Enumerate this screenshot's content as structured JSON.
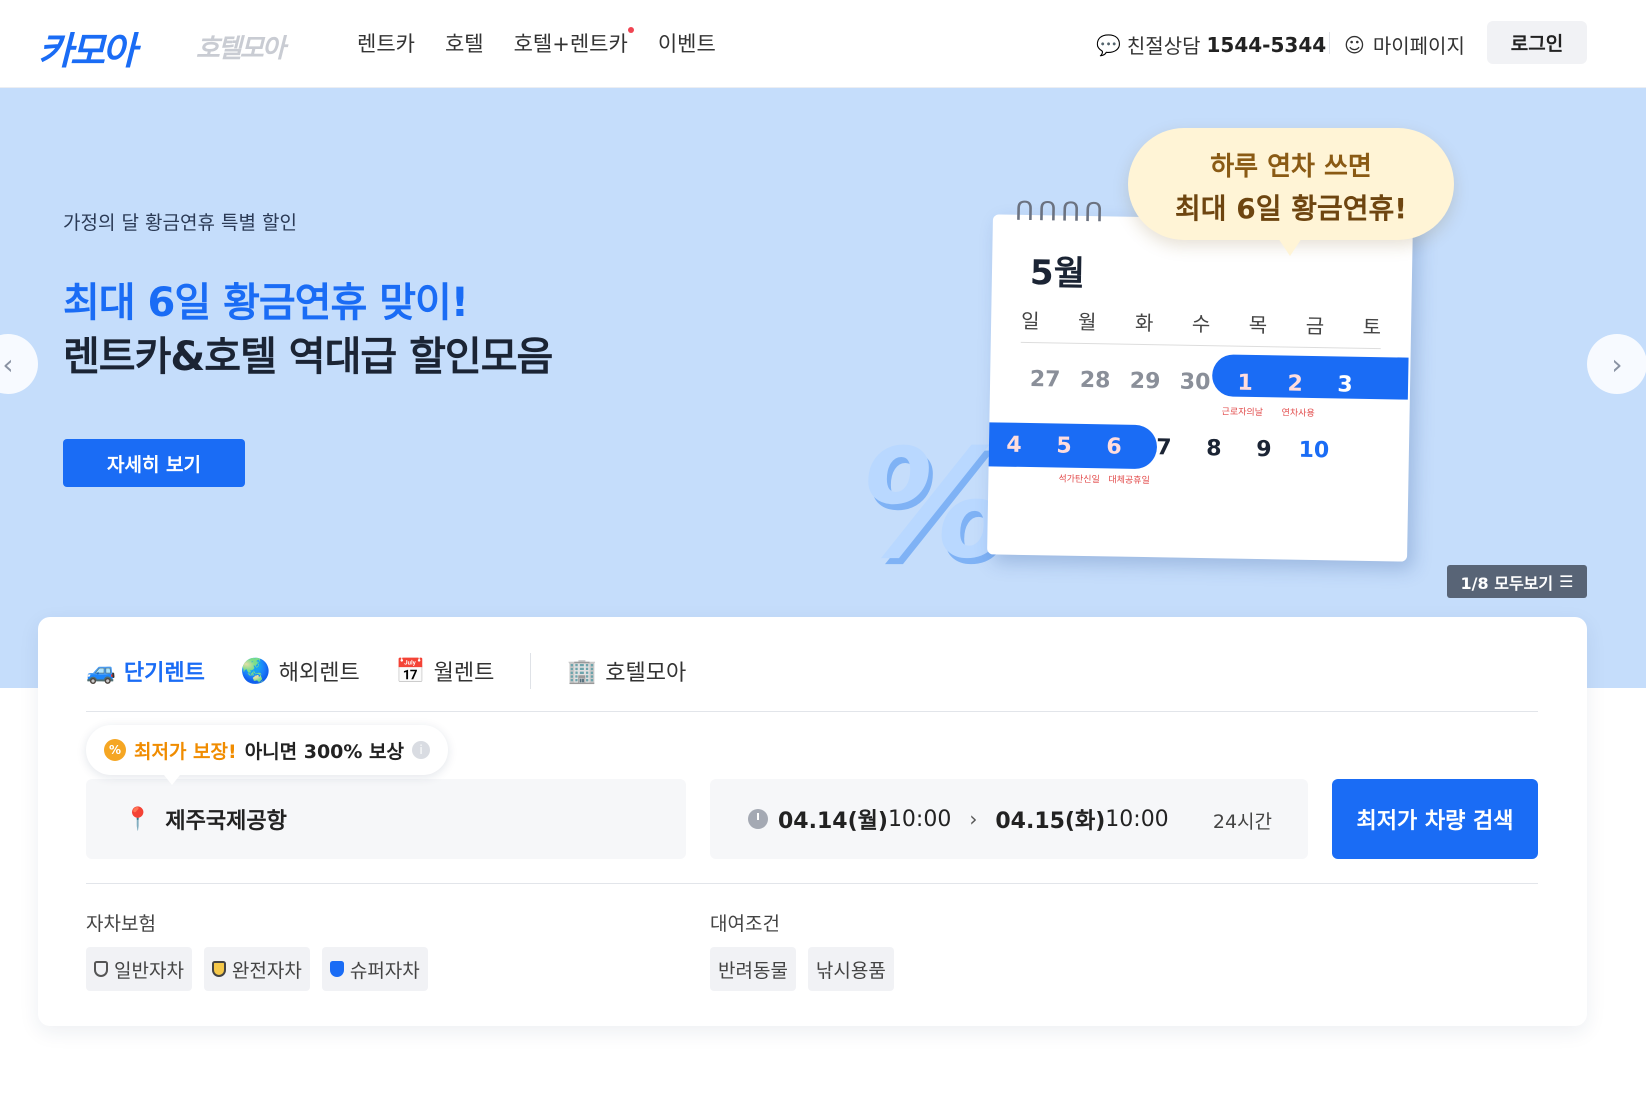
{
  "header": {
    "logo": "카모아",
    "logo_sub": "호텔모아",
    "nav": [
      "렌트카",
      "호텔",
      "호텔+렌트카",
      "이벤트"
    ],
    "consult_label": "친절상담",
    "consult_phone": "1544-5344",
    "mypage": "마이페이지",
    "login": "로그인"
  },
  "hero": {
    "eyebrow": "가정의 달 황금연휴 특별 할인",
    "title_line1": "최대 6일 황금연휴 맞이!",
    "title_line2": "렌트카&호텔 역대급 할인모음",
    "cta": "자세히 보기",
    "pager": "1/8 모두보기",
    "speech_line1": "하루 연차 쓰면",
    "speech_line2": "최대 6일 황금연휴!",
    "calendar": {
      "month": "5월",
      "weekdays": [
        "일",
        "월",
        "화",
        "수",
        "목",
        "금",
        "토"
      ],
      "row1": [
        "27",
        "28",
        "29",
        "30",
        "1",
        "2",
        "3"
      ],
      "row2": [
        "4",
        "5",
        "6",
        "7",
        "8",
        "9",
        "10"
      ],
      "note1": "근로자의날",
      "note2": "연차사용",
      "note3": "석가탄신일",
      "note4": "대체공휴일"
    },
    "colors": {
      "background": "#c5ddfb",
      "accent": "#1a6cf5"
    }
  },
  "booking": {
    "tabs": [
      "단기렌트",
      "해외렌트",
      "월렌트",
      "호텔모아"
    ],
    "active_tab": "단기렌트",
    "badge_highlight": "최저가 보장!",
    "badge_rest": "아니면 300% 보상",
    "location": "제주국제공항",
    "pickup_date": "04.14(월)",
    "pickup_time": "10:00",
    "return_date": "04.15(화)",
    "return_time": "10:00",
    "duration": "24시간",
    "search": "최저가 차량 검색",
    "insurance_title": "자차보험",
    "insurance_options": [
      "일반자차",
      "완전자차",
      "슈퍼자차"
    ],
    "conditions_title": "대여조건",
    "conditions_options": [
      "반려동물",
      "낚시용품"
    ]
  }
}
